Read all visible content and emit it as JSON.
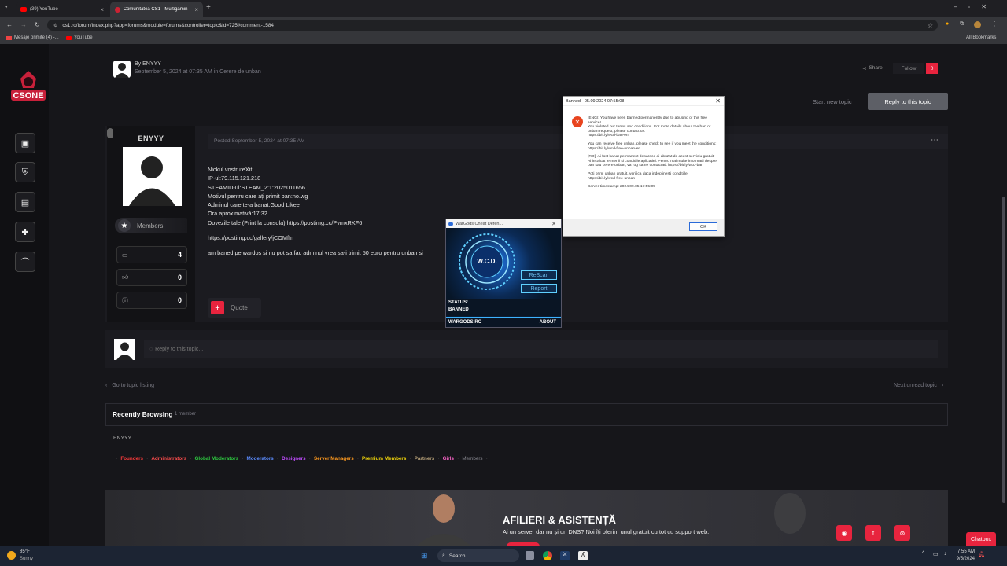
{
  "browser": {
    "tabs": [
      {
        "title": "(39) YouTube",
        "active": false
      },
      {
        "title": "Comunitatea CS1 - Multigamin",
        "active": true
      }
    ],
    "url": "cs1.ro/forum/index.php?app=forums&module=forums&controller=topic&id=725#comment-1584",
    "bookmarks": [
      "Mesaje primite (4) -...",
      "YouTube"
    ],
    "all_bookmarks": "All Bookmarks"
  },
  "header": {
    "by_label": "By ENYYY",
    "date_line": "September 5, 2024 at 07:35 AM in Cerere de unban",
    "share": "Share",
    "follow": "Follow",
    "follow_count": "0",
    "start_topic": "Start new topic",
    "reply_topic": "Reply to this topic"
  },
  "author": {
    "name": "ENYYY",
    "group": "Members",
    "stats": [
      "4",
      "0",
      "0"
    ]
  },
  "post": {
    "posted": "Posted September 5, 2024 at 07:35 AM",
    "lines": [
      "Nickul vostru:eXit",
      "IP-ul:79.115.121.218",
      "STEAMID-ul:STEAM_2:1:2025011656",
      "Motivul pentru care ați primit ban:no.wg",
      "Adminul care te-a banat:Good Likee",
      "Ora aproximativă:17:32"
    ],
    "evidence_label": "Dovezile tale (Print la consola):",
    "evidence_link": "https://postimg.cc/PvmxRKF6",
    "gallery_link": "https://postimg.cc/gallery/jCOMfIn",
    "body": "am baned pe wardos si nu pot sa fac adminul vrea sa-i trimit 50 euro pentru unban si",
    "quote": "Quote"
  },
  "reply_box": {
    "placeholder": "Reply to this topic..."
  },
  "nav": {
    "prev": "Go to topic listing",
    "next": "Next unread topic"
  },
  "browsing": {
    "title": "Recently Browsing",
    "count": "1 member",
    "user": "ENYYY"
  },
  "ranks": [
    {
      "label": "Founders",
      "color": "#ff3b3b"
    },
    {
      "label": "Administrators",
      "color": "#ff4d4d"
    },
    {
      "label": "Global Moderators",
      "color": "#2ecc40"
    },
    {
      "label": "Moderators",
      "color": "#5b8cff"
    },
    {
      "label": "Designers",
      "color": "#c04dff"
    },
    {
      "label": "Server Managers",
      "color": "#ff9a1f"
    },
    {
      "label": "Premium Members",
      "color": "#f5d90a"
    },
    {
      "label": "Partners",
      "color": "#b9a37a"
    },
    {
      "label": "Girls",
      "color": "#ff66cc"
    },
    {
      "label": "Members",
      "color": "#8a8a92"
    }
  ],
  "banner": {
    "title": "AFILIERI & ASISTENȚĂ",
    "text": "Ai un server dar nu și un DNS? Noi îți oferim unul gratuit cu tot cu support web."
  },
  "chatbox": "Chatbox",
  "ban_dialog": {
    "title": "Banned - 05.09.2024 07:55:08",
    "paragraphs": [
      "[ENG]: You have been banned permanently due to abusing of this free service!",
      "You violated our terms and conditions. For more details about the ban or unban request, please contact us:",
      "https://bit.ly/wcd-ban-en",
      "You can receive free unban, please check to see if you meet the conditions: https://bit.ly/wcd-free-unban-en",
      "[RO]: Ai fost banat permanent deoarece ai abuzat de acest serviciu gratuit!",
      "Ai incalcat termenii si conditiile aplicatiei. Pentru mai multe informatii despre ban sau cerere unban, va rog sa ne contactati: https://bit.ly/wcd-ban",
      "Poti primi unban gratuit, verifica daca indeplinesti conditiile: https://bit.ly/wcd-free-unban",
      "Server timestamp: 2024.09.05 17:55:05"
    ],
    "ok": "OK"
  },
  "wargods": {
    "title": "WarGods Cheat Defen...",
    "logo": "W.C.D.",
    "rescan": "ReScan",
    "report": "Report",
    "status_label": "STATUS:",
    "status_value": "BANNED",
    "site": "WARGODS.RO",
    "about": "ABOUT"
  },
  "taskbar": {
    "temp": "85°F",
    "weather": "Sunny",
    "search": "Search",
    "time": "7:55 AM",
    "date": "9/5/2024"
  }
}
